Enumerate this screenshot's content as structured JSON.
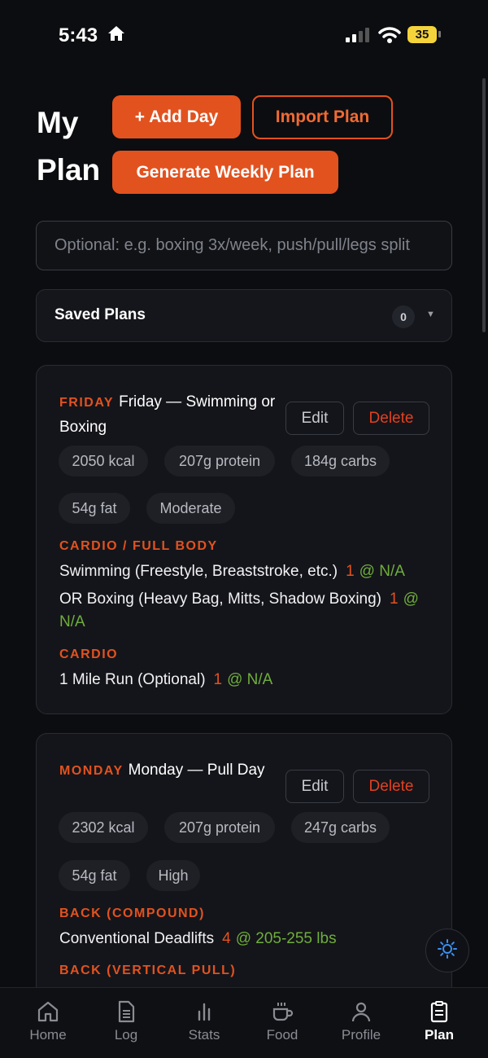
{
  "status": {
    "time": "5:43",
    "battery": "35"
  },
  "header": {
    "title": "My Plan",
    "add_day": "+ Add Day",
    "import_plan": "Import Plan",
    "generate": "Generate Weekly Plan"
  },
  "prompt": {
    "placeholder": "Optional: e.g. boxing 3x/week, push/pull/legs split"
  },
  "saved_plans": {
    "label": "Saved Plans",
    "count": "0"
  },
  "days": [
    {
      "tag": "FRIDAY",
      "title": "Friday — Swimming or Boxing",
      "edit": "Edit",
      "delete": "Delete",
      "pills": [
        "2050 kcal",
        "207g protein",
        "184g carbs",
        "54g fat",
        "Moderate"
      ],
      "sections": [
        {
          "title": "CARDIO / FULL BODY",
          "exercises": [
            {
              "name": "Swimming (Freestyle, Breaststroke, etc.)",
              "sets": "1",
              "weight": "@ N/A"
            },
            {
              "name": "OR Boxing (Heavy Bag, Mitts, Shadow Boxing)",
              "sets": "1",
              "weight": "@ N/A"
            }
          ]
        },
        {
          "title": "CARDIO",
          "exercises": [
            {
              "name": "1 Mile Run (Optional)",
              "sets": "1",
              "weight": "@ N/A"
            }
          ]
        }
      ]
    },
    {
      "tag": "MONDAY",
      "title": "Monday — Pull Day",
      "edit": "Edit",
      "delete": "Delete",
      "pills": [
        "2302 kcal",
        "207g protein",
        "247g carbs",
        "54g fat",
        "High"
      ],
      "sections": [
        {
          "title": "BACK (COMPOUND)",
          "exercises": [
            {
              "name": "Conventional Deadlifts",
              "sets": "4",
              "weight": "@ 205-255 lbs"
            }
          ]
        },
        {
          "title": "BACK (VERTICAL PULL)",
          "exercises": []
        }
      ]
    }
  ],
  "nav": [
    {
      "label": "Home",
      "icon": "home-icon"
    },
    {
      "label": "Log",
      "icon": "log-icon"
    },
    {
      "label": "Stats",
      "icon": "stats-icon"
    },
    {
      "label": "Food",
      "icon": "food-icon"
    },
    {
      "label": "Profile",
      "icon": "profile-icon"
    },
    {
      "label": "Plan",
      "icon": "plan-icon",
      "active": true
    }
  ],
  "colors": {
    "accent": "#e2521f",
    "green": "#6fae3c",
    "background": "#0c0d10"
  }
}
